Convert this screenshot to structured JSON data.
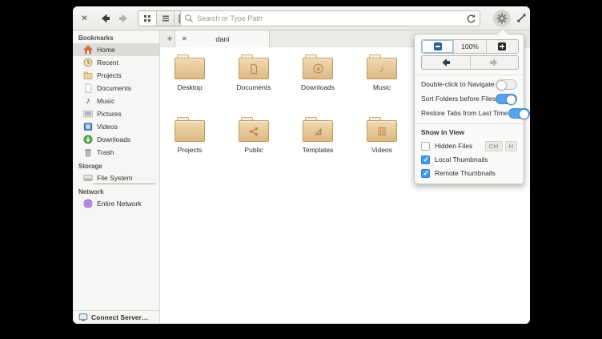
{
  "toolbar": {
    "close_label": "✕",
    "search_placeholder": "Search or Type Path"
  },
  "tabbar": {
    "new_tab_label": "+",
    "tab_close_label": "✕",
    "tab_label": "dani"
  },
  "sidebar": {
    "bookmarks_header": "Bookmarks",
    "bookmarks": [
      {
        "label": "Home",
        "selected": true
      },
      {
        "label": "Recent"
      },
      {
        "label": "Projects"
      },
      {
        "label": "Documents"
      },
      {
        "label": "Music"
      },
      {
        "label": "Pictures"
      },
      {
        "label": "Videos"
      },
      {
        "label": "Downloads"
      },
      {
        "label": "Trash"
      }
    ],
    "storage_header": "Storage",
    "storage": [
      {
        "label": "File System"
      }
    ],
    "network_header": "Network",
    "network": [
      {
        "label": "Entire Network"
      }
    ],
    "connect_server": "Connect Server…",
    "music_glyph": "♪"
  },
  "files": [
    {
      "label": "Desktop"
    },
    {
      "label": "Documents"
    },
    {
      "label": "Downloads"
    },
    {
      "label": "Music"
    },
    {
      "label": "Projects"
    },
    {
      "label": "Public"
    },
    {
      "label": "Templates"
    },
    {
      "label": "Videos"
    }
  ],
  "files_music_glyph": "♪",
  "menu": {
    "zoom_level": "100%",
    "toggles": [
      {
        "label": "Double-click to Navigate",
        "on": false
      },
      {
        "label": "Sort Folders before Files",
        "on": true
      },
      {
        "label": "Restore Tabs from Last Time",
        "on": true
      }
    ],
    "show_in_view_header": "Show in View",
    "view_options": [
      {
        "label": "Hidden Files",
        "checked": false,
        "shortcut": [
          "Ctrl",
          "H"
        ]
      },
      {
        "label": "Local Thumbnails",
        "checked": true
      },
      {
        "label": "Remote Thumbnails",
        "checked": true
      }
    ]
  },
  "colors": {
    "accent_blue": "#57a3e8",
    "folder_tan": "#e3c190",
    "selected_row": "#dedcd8"
  }
}
